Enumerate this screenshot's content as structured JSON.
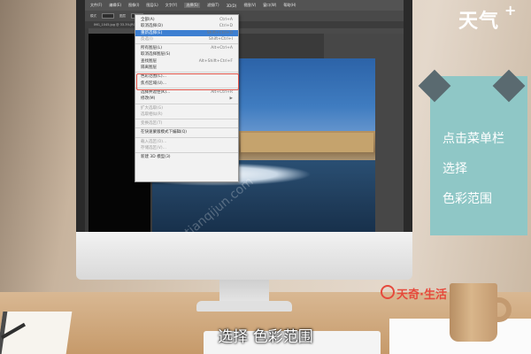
{
  "brand": {
    "top_logo": "天气",
    "top_plus": "+",
    "bottom_logo": "天奇·生活",
    "logo_icon": "q-circle-icon"
  },
  "side_banner": {
    "lines": [
      "点击菜单栏",
      "选择",
      "色彩范围"
    ]
  },
  "subtitle": "选择 色彩范围",
  "watermark": "tianqijun.com",
  "photoshop": {
    "menubar": [
      "文件(F)",
      "编辑(E)",
      "图像(I)",
      "图层(L)",
      "文字(Y)",
      "选择(S)",
      "滤镜(T)",
      "3D(D)",
      "视图(V)",
      "窗口(W)",
      "帮助(H)"
    ],
    "active_menu": "选择(S)",
    "options": [
      "模式",
      "图层",
      "不透明度"
    ],
    "doc_tab": "IMG_1045.jpg @ 33.3%(RGB/8)",
    "select_menu": {
      "items": [
        {
          "label": "全部(A)",
          "shortcut": "Ctrl+A",
          "state": "normal"
        },
        {
          "label": "取消选择(D)",
          "shortcut": "Ctrl+D",
          "state": "normal"
        },
        {
          "label": "重新选择(E)",
          "shortcut": "Shift+Ctrl+D",
          "state": "highlight"
        },
        {
          "label": "反选(I)",
          "shortcut": "Shift+Ctrl+I",
          "state": "dim"
        },
        {
          "sep": true
        },
        {
          "label": "所有图层(L)",
          "shortcut": "Alt+Ctrl+A",
          "state": "normal"
        },
        {
          "label": "取消选择图层(S)",
          "shortcut": "",
          "state": "normal"
        },
        {
          "label": "查找图层",
          "shortcut": "Alt+Shift+Ctrl+F",
          "state": "normal"
        },
        {
          "label": "隔离图层",
          "shortcut": "",
          "state": "normal"
        },
        {
          "sep": true
        },
        {
          "label": "色彩范围(C)...",
          "shortcut": "",
          "state": "normal"
        },
        {
          "label": "焦点区域(U)...",
          "shortcut": "",
          "state": "normal"
        },
        {
          "sep": true
        },
        {
          "label": "选择并遮住(K)...",
          "shortcut": "Alt+Ctrl+R",
          "state": "normal"
        },
        {
          "label": "修改(M)",
          "shortcut": "▶",
          "state": "normal"
        },
        {
          "sep": true
        },
        {
          "label": "扩大选取(G)",
          "shortcut": "",
          "state": "dim"
        },
        {
          "label": "选取相似(R)",
          "shortcut": "",
          "state": "dim"
        },
        {
          "sep": true
        },
        {
          "label": "变换选区(T)",
          "shortcut": "",
          "state": "dim"
        },
        {
          "sep": true
        },
        {
          "label": "在快速蒙版模式下编辑(Q)",
          "shortcut": "",
          "state": "normal"
        },
        {
          "sep": true
        },
        {
          "label": "载入选区(O)...",
          "shortcut": "",
          "state": "dim"
        },
        {
          "label": "存储选区(V)...",
          "shortcut": "",
          "state": "dim"
        },
        {
          "sep": true
        },
        {
          "label": "新建 3D 模型(3)",
          "shortcut": "",
          "state": "normal"
        }
      ]
    }
  },
  "colors": {
    "banner": "#8fc7c6",
    "highlight": "#3d7fd1",
    "outline": "#e2554a",
    "brand_red": "#e64a3c"
  }
}
